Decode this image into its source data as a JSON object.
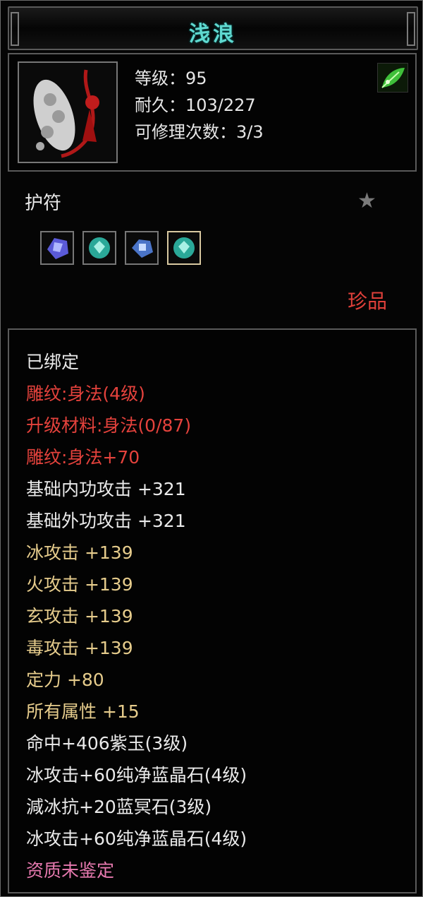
{
  "item": {
    "name": "浅浪",
    "level": "等级：95",
    "durability": "耐久：103/227",
    "repairs": "可修理次数：3/3",
    "type": "护符",
    "rarity": "珍品"
  },
  "icons": {
    "thumbnail": "amulet-jade-icon",
    "corner": "green-leaf-icon",
    "favorite": "star-icon",
    "gems": [
      "purple-gem-icon",
      "teal-gem-icon",
      "blue-gem-icon",
      "teal-gem-icon"
    ]
  },
  "colors": {
    "title": "#5fd9d0",
    "white": "#eaeaea",
    "red": "#e4423c",
    "gold": "#e6cc8c",
    "pink": "#e87ab0"
  },
  "properties": [
    {
      "text": "已绑定",
      "color": "white"
    },
    {
      "text": "雕纹:身法(4级)",
      "color": "red"
    },
    {
      "text": "升级材料:身法(0/87)",
      "color": "red"
    },
    {
      "text": "雕纹:身法+70",
      "color": "red"
    },
    {
      "text": "基础内功攻击  +321",
      "color": "white"
    },
    {
      "text": "基础外功攻击  +321",
      "color": "white"
    },
    {
      "text": "冰攻击  +139",
      "color": "gold"
    },
    {
      "text": "火攻击  +139",
      "color": "gold"
    },
    {
      "text": "玄攻击  +139",
      "color": "gold"
    },
    {
      "text": "毒攻击  +139",
      "color": "gold"
    },
    {
      "text": "定力  +80",
      "color": "gold"
    },
    {
      "text": "所有属性  +15",
      "color": "gold"
    },
    {
      "text": "命中+406紫玉(3级)",
      "color": "white"
    },
    {
      "text": "冰攻击+60纯净蓝晶石(4级)",
      "color": "white"
    },
    {
      "text": "減冰抗+20蓝冥石(3级)",
      "color": "white"
    },
    {
      "text": "冰攻击+60纯净蓝晶石(4级)",
      "color": "white"
    },
    {
      "text": "资质未鉴定",
      "color": "pink"
    }
  ]
}
